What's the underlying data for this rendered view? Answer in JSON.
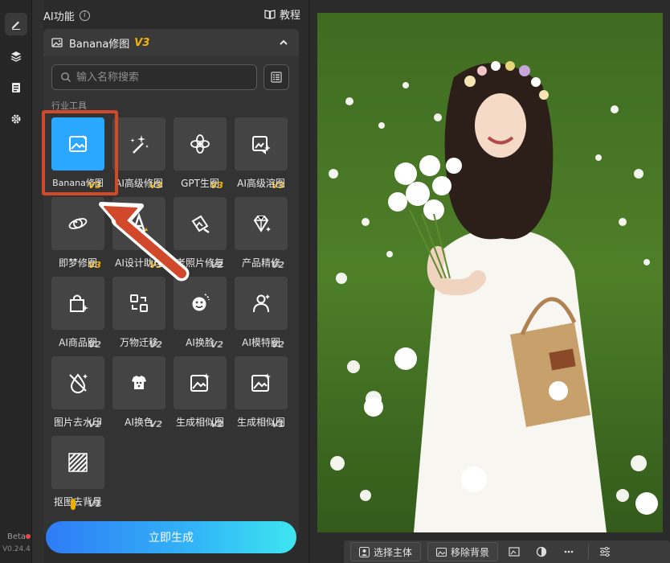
{
  "header": {
    "title": "AI功能",
    "tutorial_label": "教程"
  },
  "dropdown": {
    "name": "Banana修图",
    "version": "V3"
  },
  "search": {
    "placeholder": "输入名称搜索"
  },
  "section_title": "行业工具",
  "tools": [
    {
      "label": "Banana修图",
      "badge": "V3",
      "icon": "image-edit-icon",
      "selected": true
    },
    {
      "label": "AI高级修图",
      "badge": "V3",
      "icon": "magic-wand-icon"
    },
    {
      "label": "GPT生图",
      "badge": "V3",
      "icon": "gpt-knot-icon"
    },
    {
      "label": "AI高级溶图",
      "badge": "V3",
      "icon": "image-blend-icon"
    },
    {
      "label": "即梦修图",
      "badge": "V3",
      "icon": "dream-icon"
    },
    {
      "label": "AI设计助理",
      "badge": "V3",
      "icon": "design-assist-icon"
    },
    {
      "label": "老照片修复",
      "badge": "V2",
      "icon": "photo-repair-icon"
    },
    {
      "label": "产品精修",
      "badge": "V2",
      "icon": "diamond-icon"
    },
    {
      "label": "AI商品图",
      "badge": "V2",
      "icon": "shopping-bag-icon"
    },
    {
      "label": "万物迁移",
      "badge": "V2",
      "icon": "transfer-icon"
    },
    {
      "label": "AI换脸",
      "badge": "V2",
      "icon": "face-swap-icon"
    },
    {
      "label": "AI模特图",
      "badge": "V2",
      "icon": "model-icon"
    },
    {
      "label": "图片去水印",
      "badge": "V2",
      "icon": "watermark-remove-icon"
    },
    {
      "label": "AI换色",
      "badge": "V2",
      "icon": "palette-icon"
    },
    {
      "label": "生成相似图",
      "badge": "V2",
      "icon": "similar-image-icon"
    },
    {
      "label": "生成相似图",
      "badge": "V1",
      "icon": "similar-image-icon"
    },
    {
      "label": "抠图去背景",
      "badge": "V1",
      "icon": "cutout-icon"
    }
  ],
  "cta": {
    "label": "立即生成"
  },
  "rail": {
    "beta": "Beta",
    "version": "V0.24.4"
  },
  "toolbar": {
    "select_subject": "选择主体",
    "remove_background": "移除背景"
  },
  "colors": {
    "accent": "#2aa7ff",
    "badge_v3": "#f4b400",
    "highlight": "#d2482b"
  }
}
